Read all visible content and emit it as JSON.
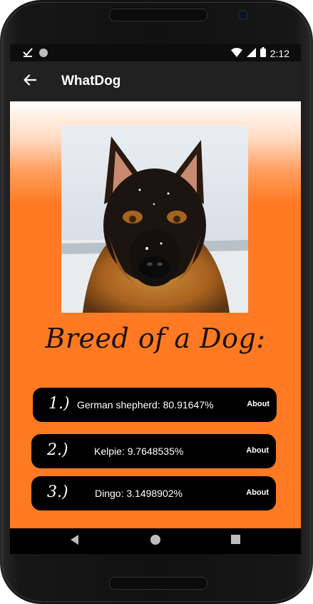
{
  "status_bar": {
    "time": "2:12",
    "left_icons": [
      "checkmark-icon",
      "circle-icon"
    ],
    "right_icons": [
      "wifi-icon",
      "signal-icon",
      "battery-icon"
    ]
  },
  "app_bar": {
    "title": "WhatDog",
    "back_icon": "arrow-left-icon"
  },
  "main": {
    "photo_alt": "dog-photo",
    "heading": "Breed of a Dog:",
    "results": [
      {
        "rank": "1.)",
        "label": "German shepherd: 80.91647%",
        "action": "About"
      },
      {
        "rank": "2.)",
        "label": "Kelpie: 9.7648535%",
        "action": "About"
      },
      {
        "rank": "3.)",
        "label": "Dingo: 3.1498902%",
        "action": "About"
      }
    ]
  },
  "nav_bar": {
    "icons": [
      "back-triangle-icon",
      "home-circle-icon",
      "recents-square-icon"
    ]
  },
  "colors": {
    "accent": "#ff7a22",
    "app_bar": "#212121",
    "result_bg": "#000000"
  }
}
